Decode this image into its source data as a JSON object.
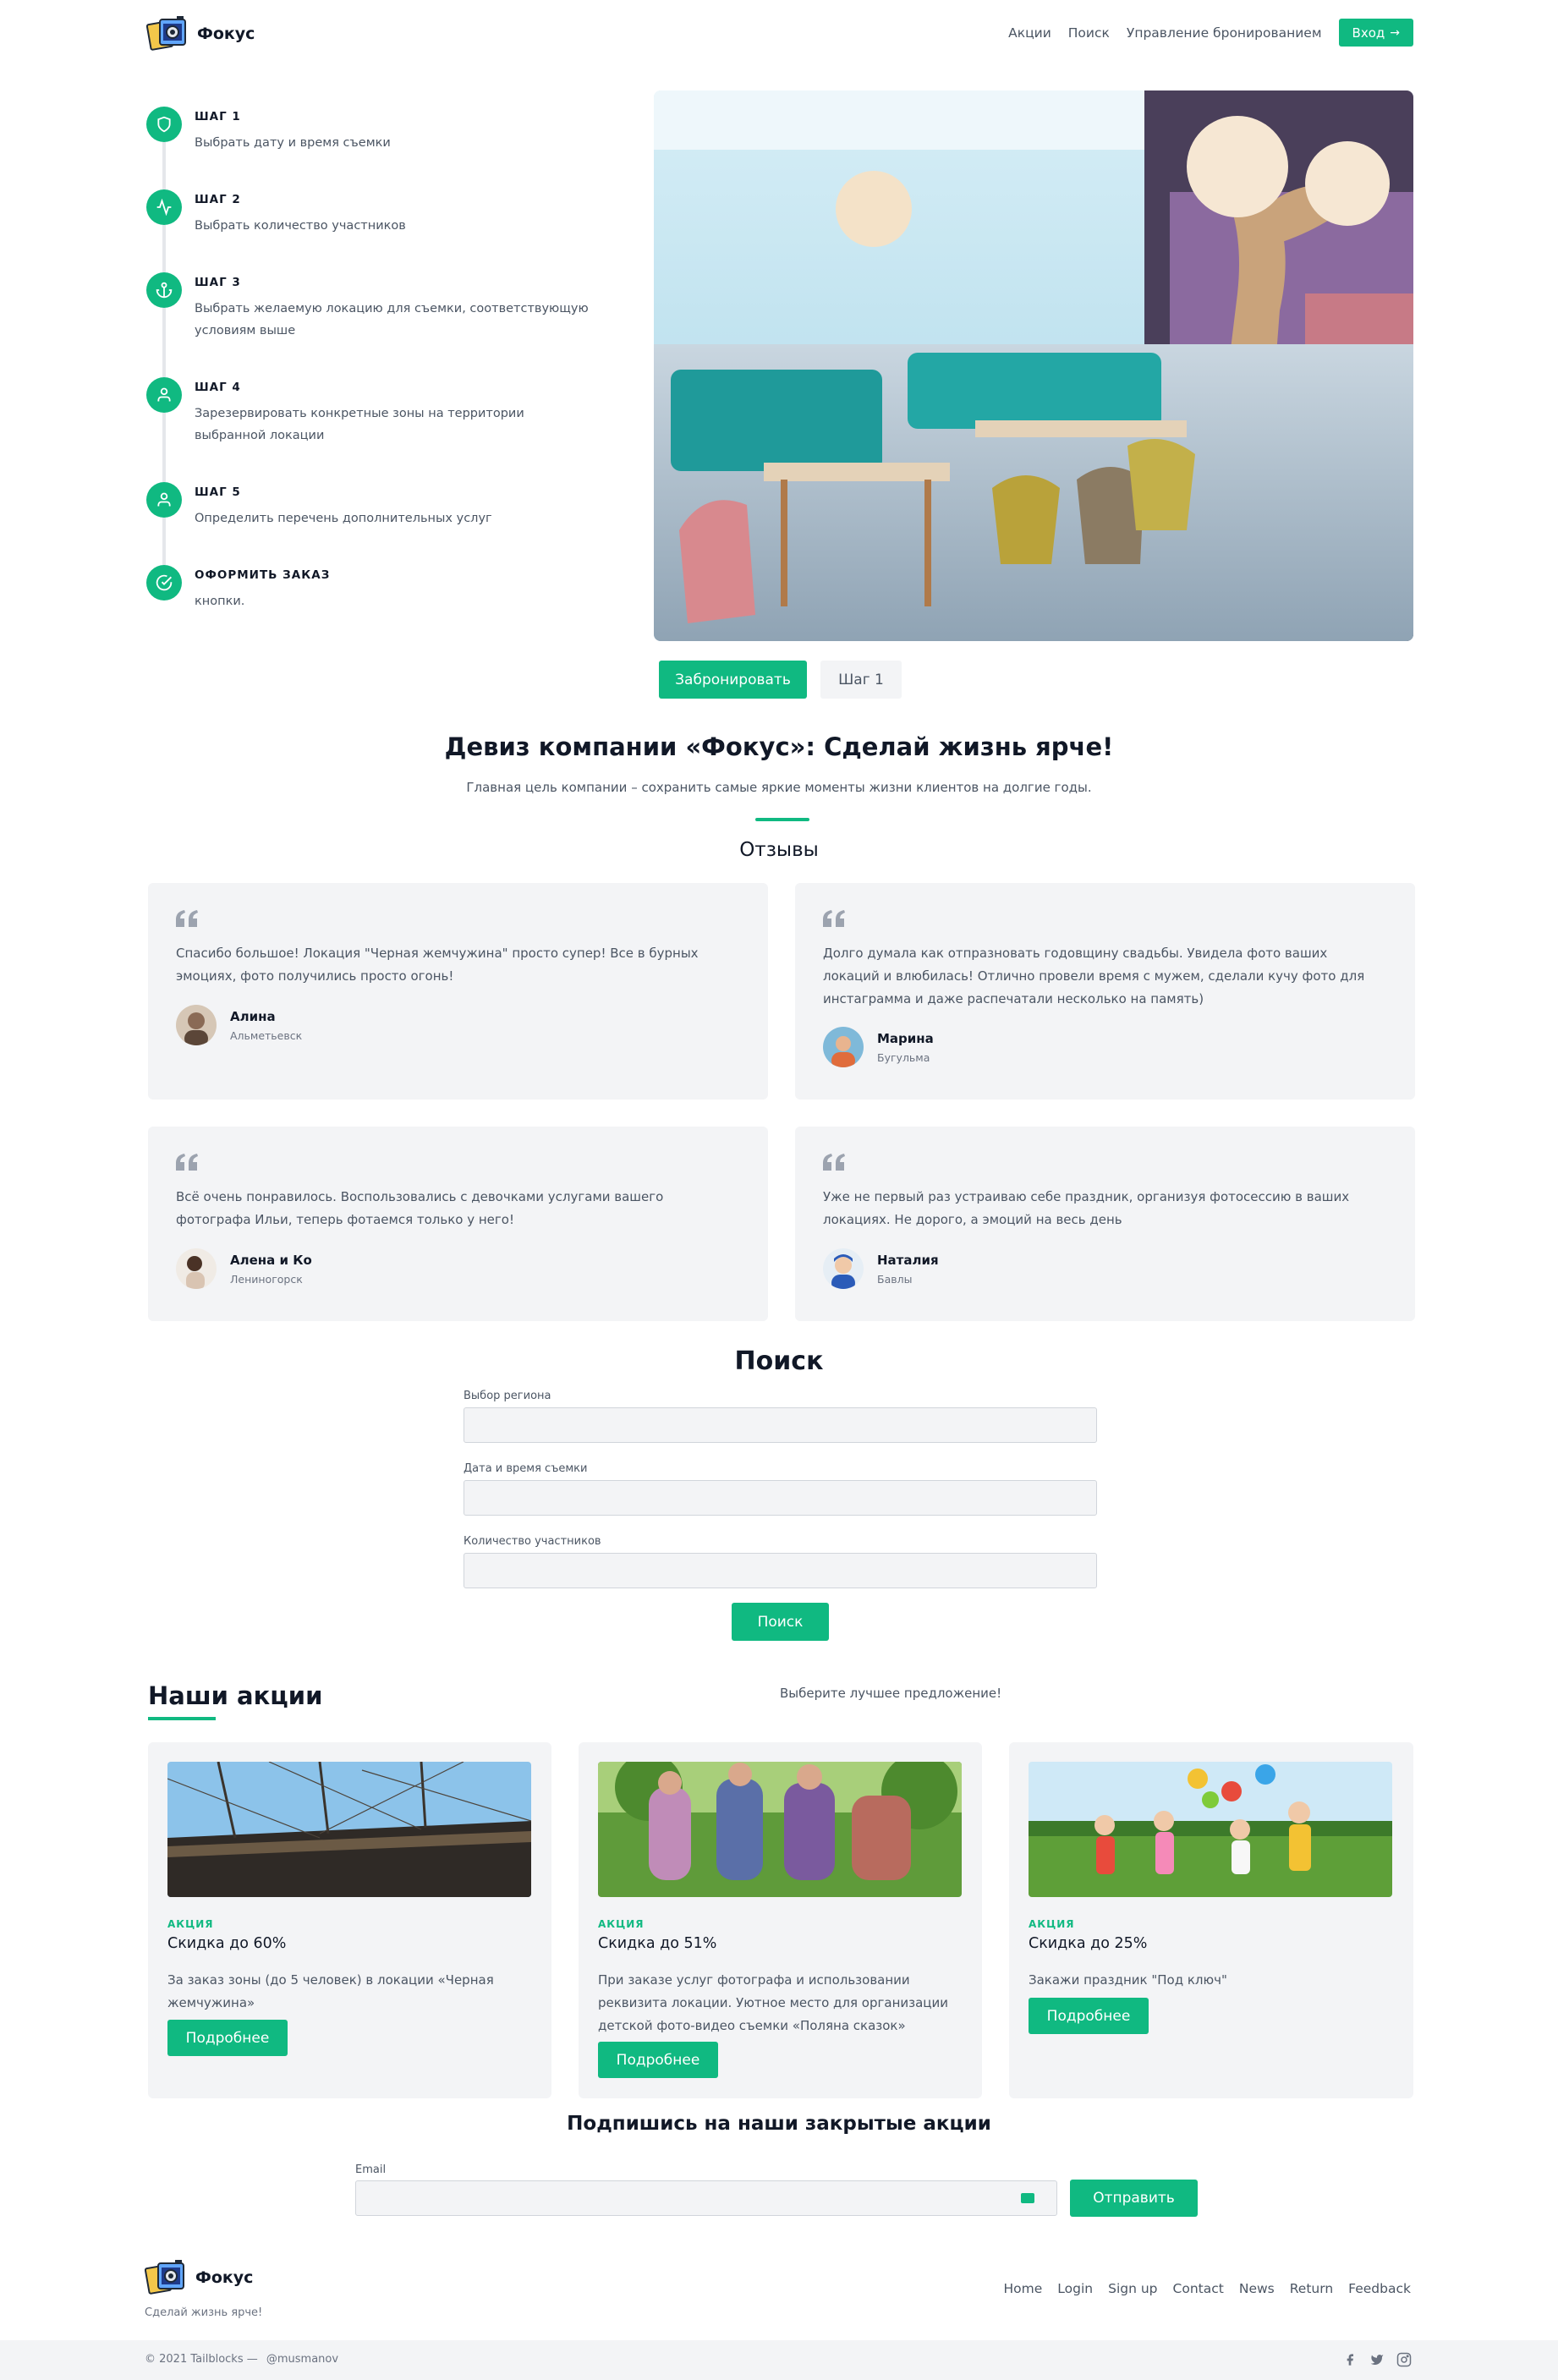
{
  "header": {
    "brand": "Фокус",
    "nav": [
      "Акции",
      "Поиск",
      "Управление бронированием"
    ],
    "login_label": "Вход"
  },
  "steps": [
    {
      "title": "ШАГ 1",
      "desc": "Выбрать дату и время съемки",
      "icon": "shield-icon"
    },
    {
      "title": "ШАГ 2",
      "desc": "Выбрать количество участников",
      "icon": "activity-icon"
    },
    {
      "title": "ШАГ 3",
      "desc": "Выбрать желаемую локацию для съемки, соответствующую условиям выше",
      "icon": "anchor-icon"
    },
    {
      "title": "ШАГ 4",
      "desc": "Зарезервировать конкретные зоны на территории выбранной локации",
      "icon": "user-icon"
    },
    {
      "title": "ШАГ 5",
      "desc": "Определить перечень дополнительных услуг",
      "icon": "user-icon"
    },
    {
      "title": "ОФОРМИТЬ ЗАКАЗ",
      "desc": "кнопки.",
      "icon": "check-circle-icon"
    }
  ],
  "hero": {
    "book_label": "Забронировать",
    "step_label": "Шаг 1"
  },
  "motto": {
    "title": "Девиз компании «Фокус»: Сделай жизнь ярче!",
    "subtitle": "Главная цель компании – сохранить самые яркие моменты жизни клиентов на долгие годы."
  },
  "reviews": {
    "title": "Отзывы",
    "items": [
      {
        "text": "Спасибо большое! Локация \"Черная жемчужина\" просто супер! Все в бурных эмоциях, фото получились просто огонь!",
        "name": "Алина",
        "city": "Альметьевск"
      },
      {
        "text": "Долго думала как отпразновать годовщину свадьбы. Увидела фото ваших локаций и влюбилась! Отлично провели время с мужем, сделали кучу фото для инстаграмма и даже распечатали несколько на память)",
        "name": "Марина",
        "city": "Бугульма"
      },
      {
        "text": "Всё очень понравилось. Воспользовались с девочками услугами вашего фотографа Ильи, теперь фотаемся только у него!",
        "name": "Алена и Ко",
        "city": "Лениногорск"
      },
      {
        "text": "Уже не первый раз устраиваю себе праздник, организуя фотосессию в ваших локациях. Не дорого, а эмоций на весь день",
        "name": "Наталия",
        "city": "Бавлы"
      }
    ]
  },
  "search": {
    "title": "Поиск",
    "fields": [
      {
        "label": "Выбор региона",
        "value": ""
      },
      {
        "label": "Дата и время съемки",
        "value": ""
      },
      {
        "label": "Количество участников",
        "value": ""
      }
    ],
    "button": "Поиск"
  },
  "promos": {
    "title": "Наши акции",
    "subtitle": "Выберите лучшее предложение!",
    "items": [
      {
        "tag": "АКЦИЯ",
        "name": "Скидка до 60%",
        "text": "За заказ зоны (до 5 человек) в локации «Черная жемчужина»",
        "button": "Подробнее"
      },
      {
        "tag": "АКЦИЯ",
        "name": "Скидка до 51%",
        "text": "При заказе услуг фотографа и использовании реквизита локации. Уютное место для организации детской фото-видео съемки «Поляна сказок»",
        "button": "Подробнее"
      },
      {
        "tag": "АКЦИЯ",
        "name": "Скидка до 25%",
        "text": "Закажи праздник \"Под ключ\"",
        "button": "Подробнее"
      }
    ]
  },
  "subscribe": {
    "title": "Подпишись на наши закрытые акции",
    "email_label": "Email",
    "email_value": "",
    "button": "Отправить"
  },
  "footer": {
    "brand": "Фокус",
    "tagline": "Сделай жизнь ярче!",
    "links": [
      "Home",
      "Login",
      "Sign up",
      "Contact",
      "News",
      "Return",
      "Feedback"
    ],
    "copyright": "© 2021 Tailblocks —",
    "handle": "@musmanov",
    "social": [
      "facebook-icon",
      "twitter-icon",
      "instagram-icon"
    ]
  },
  "colors": {
    "accent": "#10b981",
    "card_bg": "#f3f4f6",
    "text": "#4b5563",
    "heading": "#111827"
  }
}
